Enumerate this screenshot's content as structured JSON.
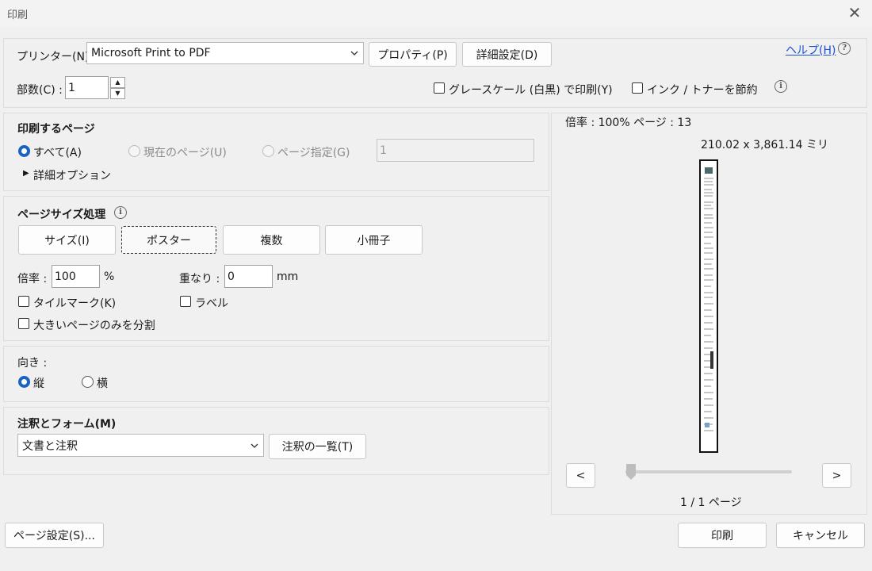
{
  "window": {
    "title": "印刷",
    "close_glyph": "✕"
  },
  "printer": {
    "label": "プリンター(N) :",
    "selected": "Microsoft Print to PDF",
    "properties_button": "プロパティ(P)",
    "advanced_button": "詳細設定(D)",
    "help_link": "ヘルプ(H)",
    "copies_label": "部数(C) :",
    "copies_value": "1",
    "grayscale_label": "グレースケール (白黒) で印刷(Y)",
    "save_ink_label": "インク / トナーを節約"
  },
  "pages_to_print": {
    "heading": "印刷するページ",
    "all_label": "すべて(A)",
    "current_label": "現在のページ(U)",
    "pages_label": "ページ指定(G)",
    "pages_value": "1",
    "more_options_label": "詳細オプション"
  },
  "page_sizing": {
    "heading": "ページサイズ処理",
    "tabs": [
      "サイズ(I)",
      "ポスター",
      "複数",
      "小冊子"
    ],
    "selected_tab": "ポスター",
    "scale_label": "倍率 :",
    "scale_value": "100",
    "scale_unit": "%",
    "overlap_label": "重なり :",
    "overlap_value": "0",
    "overlap_unit": "mm",
    "tile_marks_label": "タイルマーク(K)",
    "labels_label": "ラベル",
    "large_pages_only_label": "大きいページのみを分割"
  },
  "orientation": {
    "heading": "向き :",
    "portrait_label": "縦",
    "landscape_label": "横"
  },
  "comments_forms": {
    "heading": "注釈とフォーム(M)",
    "selected": "文書と注釈",
    "summarize_button": "注釈の一覧(T)"
  },
  "preview": {
    "scale_info": "倍率 : 100% ページ : 13",
    "dimensions": "210.02 x 3,861.14 ミリ",
    "prev_button": "<",
    "next_button": ">",
    "page_counter": "1 / 1 ページ",
    "slider_position": 0
  },
  "footer": {
    "page_setup_button": "ページ設定(S)...",
    "print_button": "印刷",
    "cancel_button": "キャンセル"
  },
  "icons": {
    "help": "question-circle-icon",
    "info": "info-circle-icon",
    "dropdown": "chevron-down-icon",
    "expand": "triangle-right-icon"
  },
  "colors": {
    "accent": "#1a62c4",
    "link": "#1a4fd6"
  }
}
